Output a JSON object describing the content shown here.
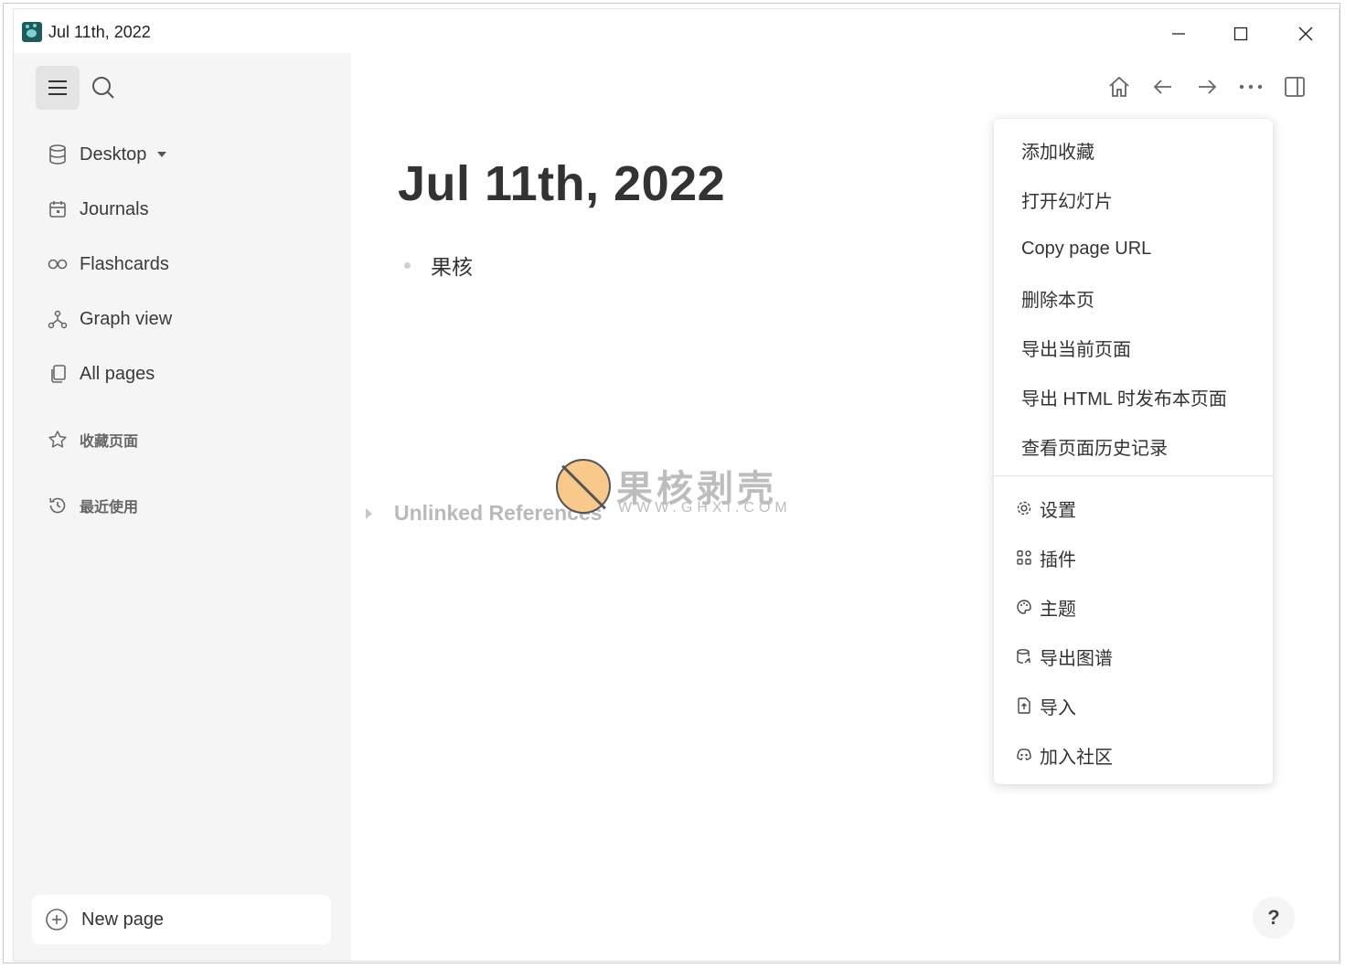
{
  "window": {
    "title": "Jul 11th, 2022"
  },
  "sidebar": {
    "items": [
      {
        "label": "Desktop",
        "icon": "database-icon"
      },
      {
        "label": "Journals",
        "icon": "calendar-icon"
      },
      {
        "label": "Flashcards",
        "icon": "infinity-icon"
      },
      {
        "label": "Graph view",
        "icon": "graph-icon"
      },
      {
        "label": "All pages",
        "icon": "pages-icon"
      }
    ],
    "favorites_label": "收藏页面",
    "recent_label": "最近使用",
    "new_page_label": "New page"
  },
  "page": {
    "title": "Jul 11th, 2022",
    "blocks": [
      "果核"
    ],
    "unlinked_references": "Unlinked References"
  },
  "watermark": {
    "text": "果核剥壳",
    "url": "WWW.GHXI.COM"
  },
  "menu": {
    "items": [
      "添加收藏",
      "打开幻灯片",
      "Copy page URL",
      "删除本页",
      "导出当前页面",
      "导出 HTML 时发布本页面",
      "查看页面历史记录"
    ],
    "settings_items": [
      {
        "label": "设置",
        "icon": "gear-icon"
      },
      {
        "label": "插件",
        "icon": "plugins-icon"
      },
      {
        "label": "主题",
        "icon": "palette-icon"
      },
      {
        "label": "导出图谱",
        "icon": "export-graph-icon"
      },
      {
        "label": "导入",
        "icon": "import-icon"
      },
      {
        "label": "加入社区",
        "icon": "discord-icon"
      }
    ]
  },
  "help": {
    "label": "?"
  }
}
